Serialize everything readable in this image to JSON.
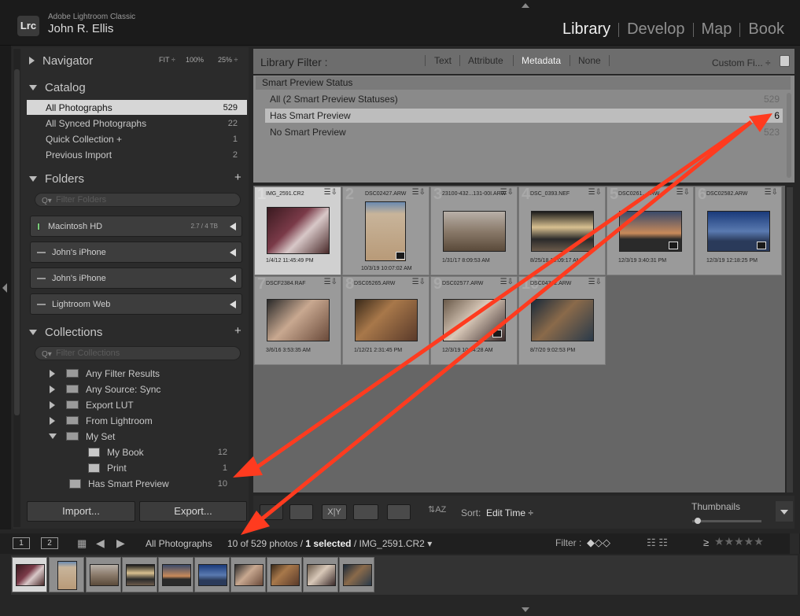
{
  "app": {
    "logo": "Lrc",
    "name": "Adobe Lightroom Classic",
    "user": "John R. Ellis"
  },
  "modules": [
    "Library",
    "Develop",
    "Map",
    "Book"
  ],
  "navigator": {
    "title": "Navigator",
    "opts": [
      "FIT ÷",
      "100%",
      "25% ÷"
    ]
  },
  "catalog": {
    "title": "Catalog",
    "items": [
      {
        "label": "All Photographs",
        "count": "529"
      },
      {
        "label": "All Synced Photographs",
        "count": "22"
      },
      {
        "label": "Quick Collection  +",
        "count": "1"
      },
      {
        "label": "Previous Import",
        "count": "2"
      }
    ]
  },
  "folders": {
    "title": "Folders",
    "search_placeholder": "Filter Folders",
    "volumes": [
      {
        "label": "Macintosh HD",
        "cap": "2.7 / 4 TB"
      },
      {
        "label": "John's iPhone",
        "cap": ""
      },
      {
        "label": "John's iPhone",
        "cap": ""
      },
      {
        "label": "Lightroom Web",
        "cap": ""
      }
    ]
  },
  "collections": {
    "title": "Collections",
    "search_placeholder": "Filter Collections",
    "items": [
      {
        "label": "Any Filter Results",
        "count": ""
      },
      {
        "label": "Any Source: Sync",
        "count": ""
      },
      {
        "label": "Export LUT",
        "count": ""
      },
      {
        "label": "From Lightroom",
        "count": ""
      },
      {
        "label": "My Set",
        "count": ""
      },
      {
        "label": "My Book",
        "count": "12"
      },
      {
        "label": "Print",
        "count": "1"
      },
      {
        "label": "Has Smart Preview",
        "count": "10"
      }
    ]
  },
  "buttons": {
    "import": "Import...",
    "export": "Export..."
  },
  "library_filter": {
    "label": "Library Filter :",
    "tabs": [
      "Text",
      "Attribute",
      "Metadata",
      "None"
    ],
    "preset": "Custom Fi... ÷"
  },
  "metadata": {
    "column_title": "Smart Preview Status",
    "rows": [
      {
        "label": "All (2 Smart Preview Statuses)",
        "count": "529"
      },
      {
        "label": "Has Smart Preview",
        "count": "6"
      },
      {
        "label": "No Smart Preview",
        "count": "523"
      }
    ]
  },
  "grid": [
    {
      "n": "1",
      "name": "IMG_2591.CR2",
      "date": "1/4/12 11:45:49 PM"
    },
    {
      "n": "2",
      "name": "DSC02427.ARW",
      "date": "10/3/19 10:07:02 AM"
    },
    {
      "n": "3",
      "name": "23100-432...131-00I.ARW",
      "date": "1/31/17 8:09:53 AM"
    },
    {
      "n": "4",
      "name": "DSC_0393.NEF",
      "date": "8/25/18 10:09:17 AM"
    },
    {
      "n": "5",
      "name": "DSC0261...ARW",
      "date": "12/3/19 3:40:31 PM"
    },
    {
      "n": "6",
      "name": "DSC02582.ARW",
      "date": "12/3/19 12:18:25 PM"
    },
    {
      "n": "7",
      "name": "DSCF2384.RAF",
      "date": "3/6/16 3:53:35 AM"
    },
    {
      "n": "8",
      "name": "DSC05265.ARW",
      "date": "1/12/21 2:31:45 PM"
    },
    {
      "n": "9",
      "name": "DSC02577.ARW",
      "date": "12/3/19 10:54:28 AM"
    },
    {
      "n": "10",
      "name": "DSC04332.ARW",
      "date": "8/7/20 9:02:53 PM"
    }
  ],
  "toolbar": {
    "sort_label": "Sort:",
    "sort_value": "Edit Time ÷",
    "thumbnails_label": "Thumbnails"
  },
  "filmstrip": {
    "monitor1": "1",
    "monitor2": "2",
    "source": "All Photographs",
    "count_pre": "10 of 529 photos /",
    "count_bold": "1 selected",
    "count_post": "/ IMG_2591.CR2 ▾",
    "filter_label": "Filter :",
    "rating_op": "≥"
  },
  "colors": {
    "arrow": "#ff3b1f",
    "accent_selected": "#d6d6d6"
  }
}
